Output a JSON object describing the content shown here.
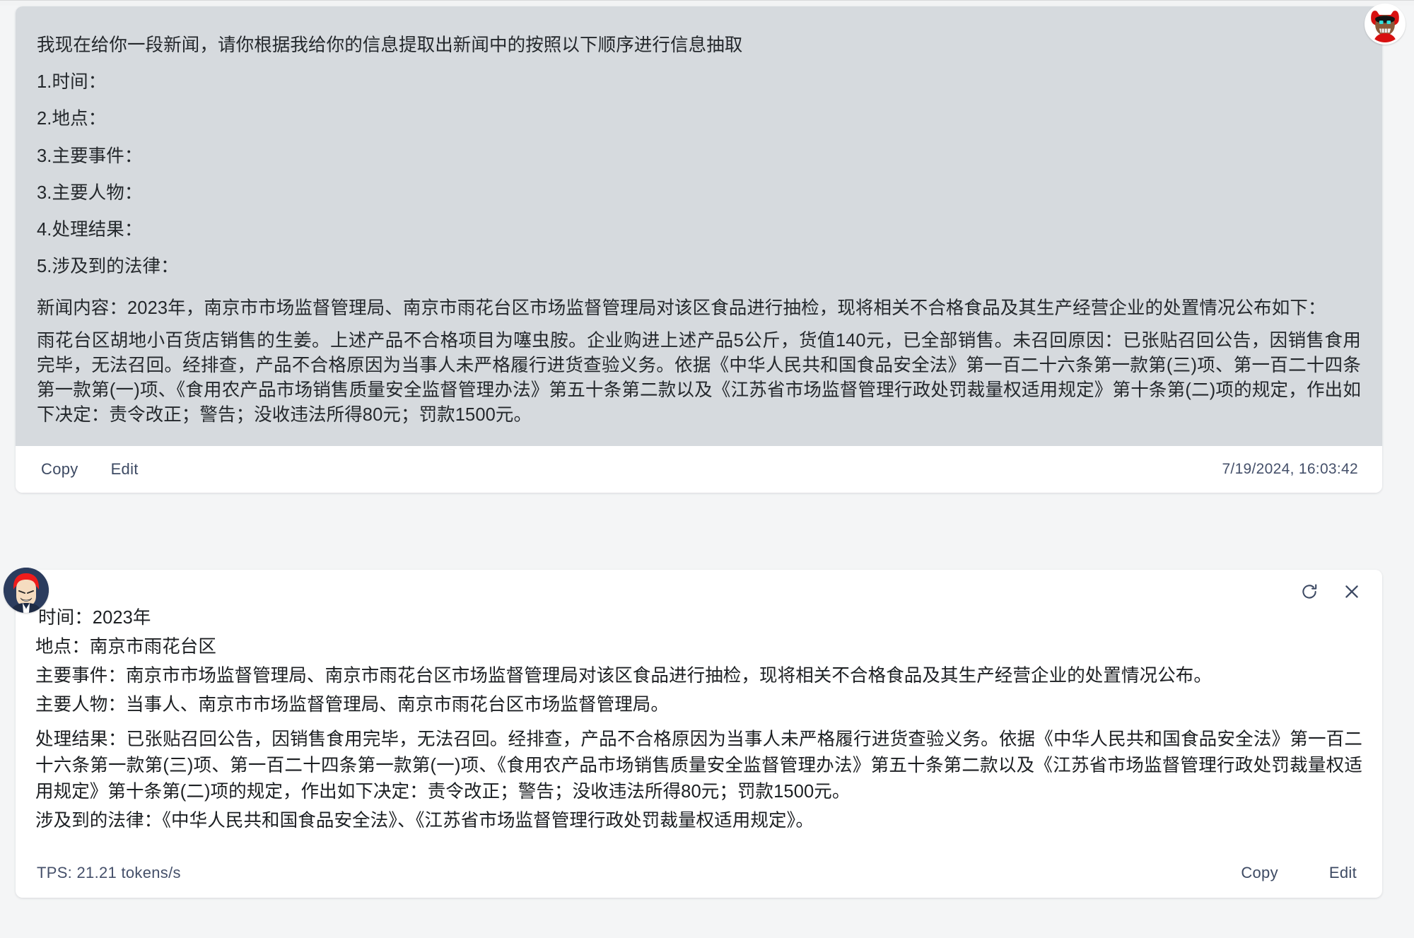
{
  "user_message": {
    "prompt_intro": "我现在给你一段新闻，请你根据我给你的信息提取出新闻中的按照以下顺序进行信息抽取",
    "fields": [
      "1.时间：",
      "2.地点：",
      "3.主要事件：",
      "3.主要人物：",
      "4.处理结果：",
      "5.涉及到的法律："
    ],
    "news_intro": "新闻内容：2023年，南京市市场监督管理局、南京市雨花台区市场监督管理局对该区食品进行抽检，现将相关不合格食品及其生产经营企业的处置情况公布如下：",
    "news_body": "雨花台区胡地小百货店销售的生姜。上述产品不合格项目为噻虫胺。企业购进上述产品5公斤，货值140元，已全部销售。未召回原因：已张贴召回公告，因销售食用完毕，无法召回。经排查，产品不合格原因为当事人未严格履行进货查验义务。依据《中华人民共和国食品安全法》第一百二十六条第一款第(三)项、第一百二十四条第一款第(一)项、《食用农产品市场销售质量安全监督管理办法》第五十条第二款以及《江苏省市场监督管理行政处罚裁量权适用规定》第十条第(二)项的规定，作出如下决定：责令改正；警告；没收违法所得80元；罚款1500元。",
    "copy_label": "Copy",
    "edit_label": "Edit",
    "timestamp": "7/19/2024, 16:03:42"
  },
  "bot_message": {
    "lines": [
      "时间：2023年",
      "地点：南京市雨花台区",
      "主要事件：南京市市场监督管理局、南京市雨花台区市场监督管理局对该区食品进行抽检，现将相关不合格食品及其生产经营企业的处置情况公布。",
      "主要人物：当事人、南京市市场监督管理局、南京市雨花台区市场监督管理局。",
      "处理结果：已张贴召回公告，因销售食用完毕，无法召回。经排查，产品不合格原因为当事人未严格履行进货查验义务。依据《中华人民共和国食品安全法》第一百二十六条第一款第(三)项、第一百二十四条第一款第(一)项、《食用农产品市场销售质量安全监督管理办法》第五十条第二款以及《江苏省市场监督管理行政处罚裁量权适用规定》第十条第(二)项的规定，作出如下决定：责令改正；警告；没收违法所得80元；罚款1500元。",
      "涉及到的法律：《中华人民共和国食品安全法》、《江苏省市场监督管理行政处罚裁量权适用规定》。"
    ],
    "tps": "TPS: 21.21 tokens/s",
    "copy_label": "Copy",
    "edit_label": "Edit",
    "regenerate_icon": "refresh-icon",
    "close_icon": "close-icon"
  },
  "colors": {
    "page_bg": "#f4f5f6",
    "user_bubble_bg": "#d6dade",
    "card_bg": "#ffffff",
    "action_text": "#3d4a63",
    "body_text": "#1c1f22",
    "bot_avatar_bg": "#2b3c5e",
    "bot_avatar_hair": "#ef1c1c"
  }
}
